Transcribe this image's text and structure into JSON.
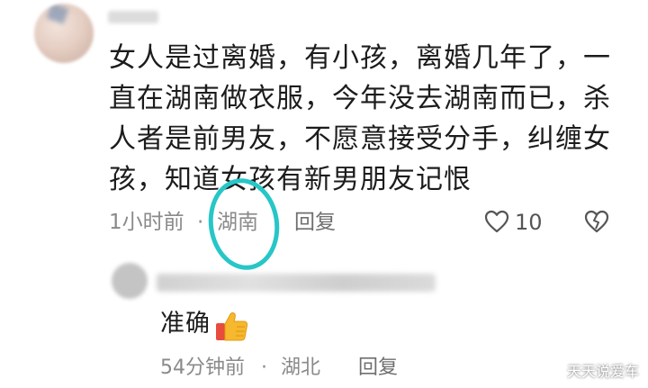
{
  "comment": {
    "text": "女人是过离婚，有小孩，离婚几年了，一直在湖南做衣服，今年没去湖南而已，杀人者是前男友，不愿意接受分手，纠缠女孩，知道女孩有新男朋友记恨",
    "time": "1小时前",
    "separator": "·",
    "location": "湖南",
    "reply_label": "回复",
    "like_count": "10"
  },
  "reply": {
    "text": "准确",
    "time": "54分钟前",
    "separator": "·",
    "location": "湖北",
    "reply_label": "回复"
  },
  "watermark": "天天说爱车",
  "colors": {
    "highlight": "#27c6c7",
    "meta_text": "#8a8a8a"
  }
}
